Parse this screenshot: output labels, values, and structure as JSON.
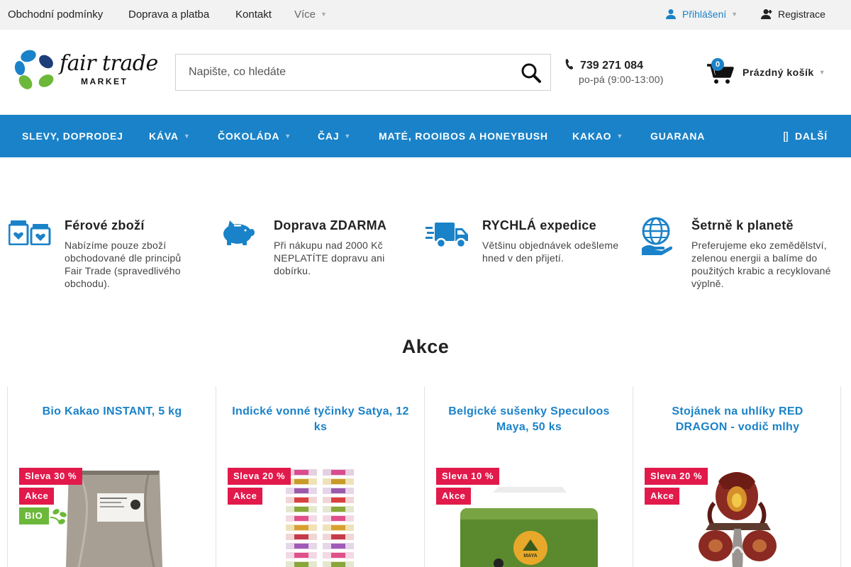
{
  "topbar": {
    "links": [
      "Obchodní podmínky",
      "Doprava a platba",
      "Kontakt"
    ],
    "more_label": "Více",
    "login_label": "Přihlášení",
    "register_label": "Registrace"
  },
  "header": {
    "logo_text": "fair trade",
    "logo_sub": "MARKET",
    "search_placeholder": "Napište, co hledáte",
    "phone": "739 271 084",
    "hours": "po-pá (9:00-13:00)",
    "cart_count": "0",
    "cart_label": "Prázdný košík"
  },
  "nav": {
    "items": [
      "SLEVY, DOPRODEJ",
      "KÁVA",
      "ČOKOLÁDA",
      "ČAJ",
      "MATÉ, ROOIBOS A HONEYBUSH",
      "KAKAO",
      "GUARANA"
    ],
    "more_label": "DALŠÍ"
  },
  "benefits": [
    {
      "icon": "jars-heart-icon",
      "title": "Férové zboží",
      "text": "Nabízíme pouze zboží obchodované dle principů Fair Trade (spravedlivého obchodu)."
    },
    {
      "icon": "piggy-bank-icon",
      "title": "Doprava ZDARMA",
      "text": "Při nákupu nad 2000 Kč NEPLATÍTE dopravu ani dobírku."
    },
    {
      "icon": "delivery-truck-icon",
      "title": "RYCHLÁ expedice",
      "text": "Většinu objednávek odešleme hned v den přijetí."
    },
    {
      "icon": "globe-hand-icon",
      "title": "Šetrně k planetě",
      "text": "Preferujeme eko zemědělství, zelenou energii a balíme do použitých krabic a recyklované výplně."
    }
  ],
  "section_title": "Akce",
  "products": [
    {
      "name": "Bio Kakao INSTANT, 5 kg",
      "discount": "Sleva 30 %",
      "tag": "Akce",
      "bio": "BIO"
    },
    {
      "name": "Indické vonné tyčinky Satya, 12 ks",
      "discount": "Sleva 20 %",
      "tag": "Akce"
    },
    {
      "name": "Belgické sušenky Speculoos Maya, 50 ks",
      "discount": "Sleva 10 %",
      "tag": "Akce",
      "brand": "MAYA"
    },
    {
      "name": "Stojánek na uhlíky RED DRAGON - vodič mlhy",
      "discount": "Sleva 20 %",
      "tag": "Akce"
    }
  ],
  "colors": {
    "accent": "#1a82c8",
    "discount": "#e2194b",
    "bio": "#6cb83a",
    "topbar_bg": "#f2f2f2"
  }
}
